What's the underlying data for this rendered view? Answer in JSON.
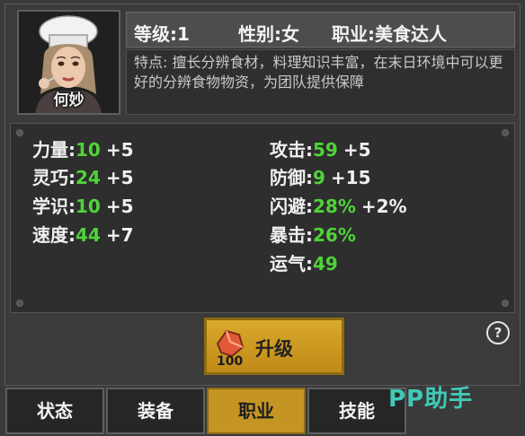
{
  "character": {
    "name": "何妙",
    "level": "等级:1",
    "gender": "性别:女",
    "profession": "职业:美食达人",
    "trait": "特点: 擅长分辨食材，料理知识丰富，在末日环境中可以更好的分辨食物物资，为团队提供保障"
  },
  "stats": {
    "left": [
      {
        "label": "力量:",
        "value": "10",
        "bonus": "+5"
      },
      {
        "label": "灵巧:",
        "value": "24",
        "bonus": "+5"
      },
      {
        "label": "学识:",
        "value": "10",
        "bonus": "+5"
      },
      {
        "label": "速度:",
        "value": "44",
        "bonus": "+7"
      }
    ],
    "right": [
      {
        "label": "攻击:",
        "value": "59",
        "bonus": "+5"
      },
      {
        "label": "防御:",
        "value": "9",
        "bonus": "+15"
      },
      {
        "label": "闪避:",
        "value": "28%",
        "bonus": "+2%"
      },
      {
        "label": "暴击:",
        "value": "26%",
        "bonus": ""
      },
      {
        "label": "运气:",
        "value": "49",
        "bonus": ""
      }
    ]
  },
  "upgrade": {
    "label": "升级",
    "cost": "100",
    "icon": "ore-icon"
  },
  "help": {
    "label": "?"
  },
  "tabs": [
    {
      "label": "状态",
      "active": false
    },
    {
      "label": "装备",
      "active": false
    },
    {
      "label": "职业",
      "active": true
    },
    {
      "label": "技能",
      "active": false
    }
  ],
  "watermark": "PP助手",
  "colors": {
    "accent": "#c49522",
    "stat_value": "#4fd339",
    "watermark": "#41c9b7"
  }
}
